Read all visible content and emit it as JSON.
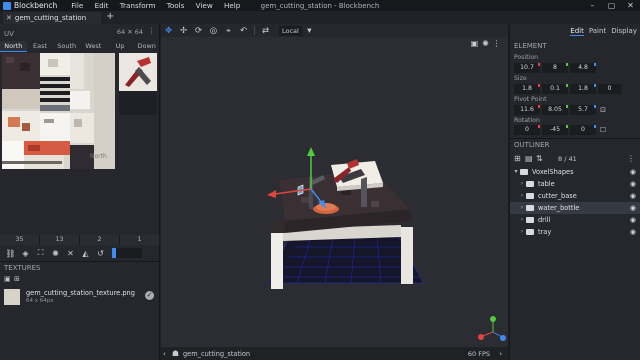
{
  "app": {
    "name": "Blockbench",
    "window_title": "gem_cutting_station - Blockbench"
  },
  "menu": [
    "File",
    "Edit",
    "Transform",
    "Tools",
    "View",
    "Help"
  ],
  "window_controls": [
    "–",
    "▢",
    "✕"
  ],
  "tab": {
    "label": "gem_cutting_station",
    "close": "✕",
    "new": "+"
  },
  "uv_panel": {
    "title": "UV",
    "size": "64 ✕ 64",
    "faces": [
      "North",
      "East",
      "South",
      "West",
      "Up",
      "Down"
    ],
    "active_face": "North",
    "counts": [
      "35",
      "13",
      "2",
      "1"
    ]
  },
  "textures": {
    "title": "TEXTURES",
    "items": [
      {
        "name": "gem_cutting_station_texture.png",
        "dims": "64 x 64px"
      }
    ]
  },
  "toolbar": {
    "space_label": "Local"
  },
  "statusbar": {
    "file": "gem_cutting_station",
    "fps": "60 FPS"
  },
  "right_panel": {
    "modes": [
      "Edit",
      "Paint",
      "Display"
    ],
    "active_mode": "Edit",
    "element_title": "ELEMENT",
    "position_label": "Position",
    "position": [
      "10.7",
      "8",
      "4.8"
    ],
    "size_label": "Size",
    "size": [
      "1.8",
      "0.1",
      "1.8",
      "0"
    ],
    "pivot_label": "Pivot Point",
    "pivot": [
      "11.6",
      "8.05",
      "5.7"
    ],
    "rotation_label": "Rotation",
    "rotation": [
      "0",
      "-45",
      "0"
    ],
    "outliner_title": "OUTLINER",
    "outliner_count": "8 / 41",
    "outliner": [
      {
        "name": "VoxelShapes",
        "depth": 0,
        "expanded": true,
        "selected": false
      },
      {
        "name": "table",
        "depth": 1,
        "expanded": false,
        "selected": false
      },
      {
        "name": "cutter_base",
        "depth": 1,
        "expanded": false,
        "selected": false
      },
      {
        "name": "water_bottle",
        "depth": 1,
        "expanded": false,
        "selected": true
      },
      {
        "name": "drill",
        "depth": 1,
        "expanded": false,
        "selected": false
      },
      {
        "name": "tray",
        "depth": 1,
        "expanded": false,
        "selected": false
      }
    ]
  },
  "colors": {
    "accent": "#3d8cf0",
    "x_axis": "#e0463c",
    "y_axis": "#4fcd3a",
    "z_axis": "#3d8cf0"
  }
}
